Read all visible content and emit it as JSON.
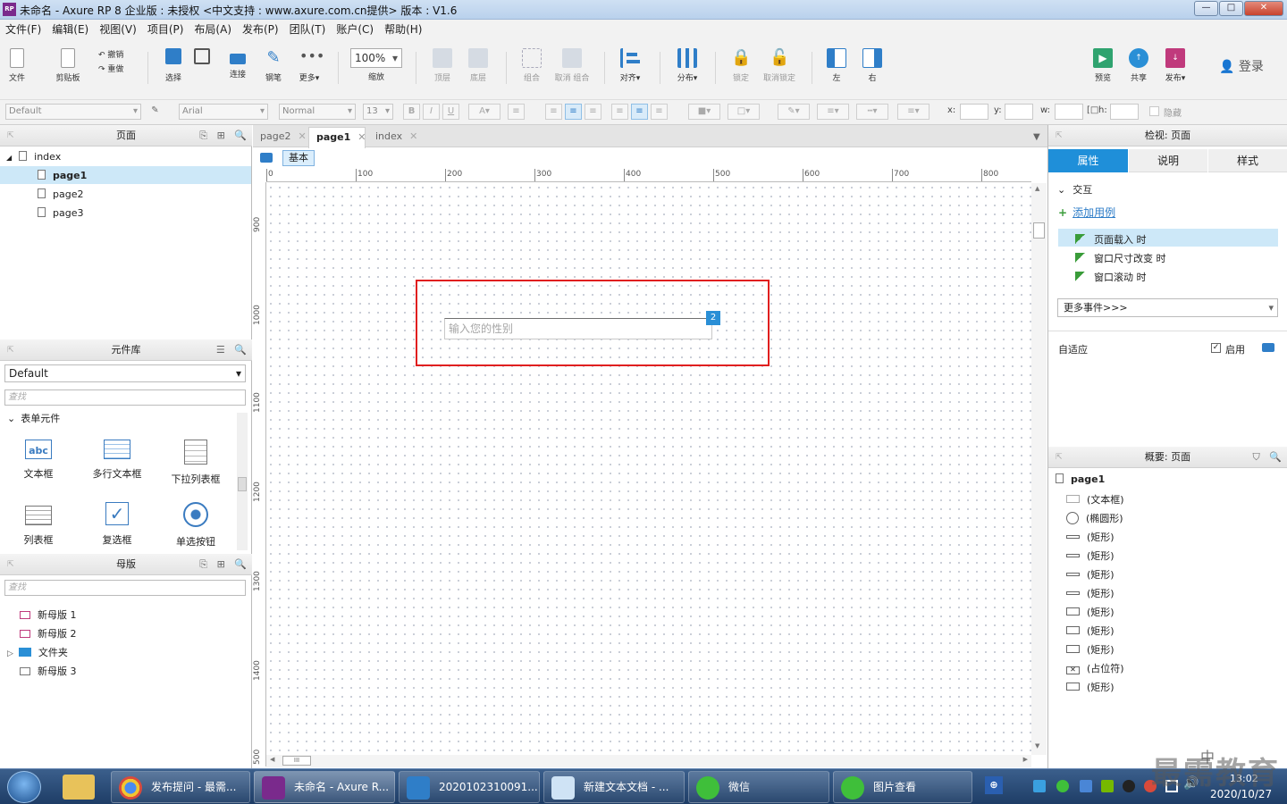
{
  "window": {
    "title": "未命名 - Axure RP 8 企业版 : 未授权     <中文支持 : www.axure.com.cn提供> 版本 : V1.6",
    "logo": "RP",
    "minimize": "—",
    "maximize": "□",
    "close": "✕"
  },
  "menu": [
    "文件(F)",
    "编辑(E)",
    "视图(V)",
    "项目(P)",
    "布局(A)",
    "发布(P)",
    "团队(T)",
    "账户(C)",
    "帮助(H)"
  ],
  "toolbar": {
    "file": "文件",
    "clipboard": "剪贴板",
    "undo": "撤销",
    "redo": "重做",
    "select": "选择",
    "connect": "连接",
    "pen": "钢笔",
    "more": "更多▾",
    "zoom_value": "100%",
    "zoom_label": "缩放",
    "top": "顶层",
    "bottom": "底层",
    "group": "组合",
    "ungroup": "取消 组合",
    "align": "对齐▾",
    "distribute": "分布▾",
    "lock": "锁定",
    "unlock": "取消锁定",
    "left": "左",
    "right": "右",
    "preview": "预览",
    "share": "共享",
    "publish": "发布▾",
    "login": "登录"
  },
  "formatbar": {
    "style": "Default",
    "font": "Arial",
    "weight": "Normal",
    "size": "13",
    "x_label": "x:",
    "y_label": "y:",
    "w_label": "w:",
    "h_label": "h:",
    "hidden_label": "隐藏"
  },
  "pages_panel": {
    "title": "页面",
    "root": "index",
    "items": [
      "page1",
      "page2",
      "page3"
    ]
  },
  "library_panel": {
    "title": "元件库",
    "library": "Default",
    "search_placeholder": "查找",
    "section": "表单元件",
    "widgets": [
      "文本框",
      "多行文本框",
      "下拉列表框",
      "列表框",
      "复选框",
      "单选按钮"
    ],
    "widget_icon_text": "abc"
  },
  "masters_panel": {
    "title": "母版",
    "search_placeholder": "查找",
    "items": [
      "新母版 1",
      "新母版 2",
      "文件夹",
      "新母版 3"
    ]
  },
  "tabs": {
    "items": [
      "page2",
      "page1",
      "index"
    ],
    "active": "page1",
    "adaptive_view": "基本"
  },
  "ruler": {
    "top": [
      "0",
      "100",
      "200",
      "300",
      "400",
      "500",
      "600",
      "700",
      "800"
    ],
    "left": [
      "900",
      "1000",
      "1100",
      "1200",
      "1300",
      "1400",
      "500"
    ]
  },
  "canvas": {
    "textbox_placeholder": "输入您的性别",
    "badge": "2",
    "scroll_label": "III"
  },
  "inspector": {
    "title": "检视: 页面",
    "tabs": [
      "属性",
      "说明",
      "样式"
    ],
    "section": "交互",
    "add_case": "添加用例",
    "events": [
      "页面载入 时",
      "窗口尺寸改变 时",
      "窗口滚动 时"
    ],
    "more_events": "更多事件>>>",
    "adaptive": "自适应",
    "enable": "启用"
  },
  "outline": {
    "title": "概要: 页面",
    "page": "page1",
    "items": [
      "(文本框)",
      "(椭圆形)",
      "(矩形)",
      "(矩形)",
      "(矩形)",
      "(矩形)",
      "(矩形)",
      "(矩形)",
      "(矩形)",
      "(占位符)",
      "(矩形)"
    ]
  },
  "taskbar": {
    "items": [
      "发布提问 - 最需...",
      "未命名 - Axure R...",
      "2020102310091...",
      "新建文本文档 - ...",
      "微信",
      "图片查看"
    ],
    "date": "2020/10/27",
    "time": "13:02",
    "ime": "中",
    "watermark": "最需教育"
  }
}
